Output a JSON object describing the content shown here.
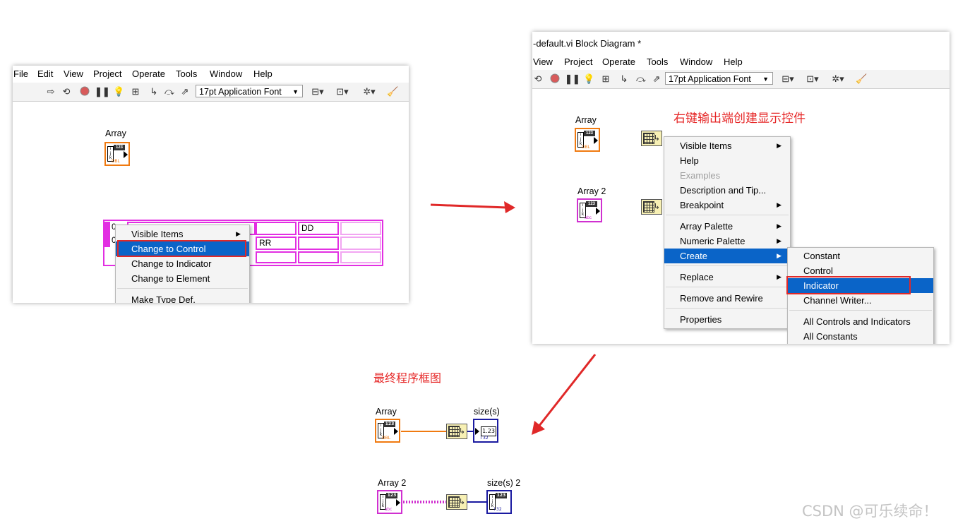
{
  "left_panel": {
    "menu": [
      "File",
      "Edit",
      "View",
      "Project",
      "Operate",
      "Tools",
      "Window",
      "Help"
    ],
    "font_select": "17pt Application Font",
    "array_label": "Array",
    "array_type_tag": "DBL",
    "array_number_tag": "123",
    "index_values": [
      "0",
      "0"
    ],
    "cells": [
      "DD",
      "RR"
    ],
    "context_menu": [
      "Visible Items",
      "Change to Control",
      "Change to Indicator",
      "Change to Element",
      "Make Type Def."
    ]
  },
  "right_panel": {
    "window_title": "-default.vi Block Diagram *",
    "menu": [
      "View",
      "Project",
      "Operate",
      "Tools",
      "Window",
      "Help"
    ],
    "font_select": "17pt Application Font",
    "annotation": "右键输出端创建显示控件",
    "array_label": "Array",
    "array2_label": "Array 2",
    "array_type_tag": "DBL",
    "array2_type_tag": "abc",
    "number_tag": "123",
    "context_menu": [
      "Visible Items",
      "Help",
      "Examples",
      "Description and Tip...",
      "Breakpoint",
      "Array Palette",
      "Numeric Palette",
      "Create",
      "Replace",
      "Remove and Rewire",
      "Properties"
    ],
    "create_submenu": [
      "Constant",
      "Control",
      "Indicator",
      "Channel Writer...",
      "All Controls and Indicators",
      "All Constants"
    ]
  },
  "final": {
    "caption": "最终程序框图",
    "array_label": "Array",
    "array2_label": "Array 2",
    "size_label": "size(s)",
    "size2_label": "size(s) 2",
    "indicator_value": "1.23",
    "indicator_tag": "I 32",
    "number_tag": "123",
    "array_type_tag": "DBL",
    "array2_type_tag": "abc"
  },
  "watermark": "CSDN @可乐续命！",
  "colors": {
    "arrow": "#e02828",
    "double_wire": "#f07a10",
    "string_wire": "#d030d0",
    "int_wire": "#1a1aa0",
    "highlight": "#0a64c8"
  }
}
